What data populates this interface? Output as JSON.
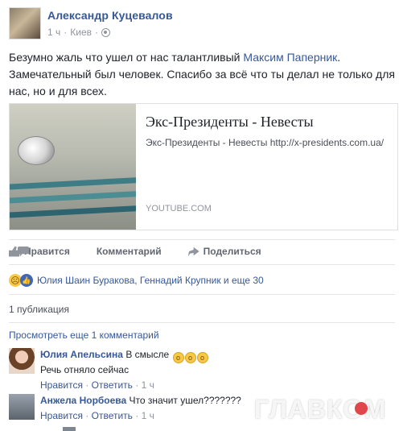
{
  "post": {
    "author": "Александр Куцевалов",
    "time": "1 ч",
    "location": "Киев",
    "text_before": "Безумно жаль что ушел от нас талантливый ",
    "mention": "Максим Паперник",
    "text_after": ". Замечательный был человек. Спасибо за всё что ты делал не только для нас, но и для всех."
  },
  "link": {
    "title": "Экс-Президенты - Невесты",
    "description": "Экс-Президенты - Невесты http://x-presidents.com.ua/",
    "domain": "YOUTUBE.COM"
  },
  "actions": {
    "like": "Нравится",
    "comment": "Комментарий",
    "share": "Поделиться"
  },
  "reactions": {
    "names": "Юлия Шаин Буракова, Геннадий Крупник и еще 30"
  },
  "shares": "1 публикация",
  "more_comments": "Просмотреть еще 1 комментарий",
  "comments": [
    {
      "name": "Юлия Апельсина",
      "text": "В смысле",
      "text2": "Речь отняло сейчас",
      "like": "Нравится",
      "reply": "Ответить",
      "time": "1 ч"
    },
    {
      "name": "Анжела Норбоева",
      "text": "Что значит ушел???????",
      "like": "Нравится",
      "reply": "Ответить",
      "time": "1 ч"
    }
  ],
  "watermark": "ГЛАВКОМ",
  "icons": {
    "globe": "globe-icon",
    "like": "thumbs-up-icon",
    "comment": "comment-icon",
    "share": "share-arrow-icon",
    "sad": "sad-reaction-icon",
    "likeReaction": "like-reaction-icon"
  },
  "colors": {
    "link": "#365899",
    "meta": "#90949c",
    "text": "#1d2129",
    "watermarkDot": "#e0464c"
  }
}
